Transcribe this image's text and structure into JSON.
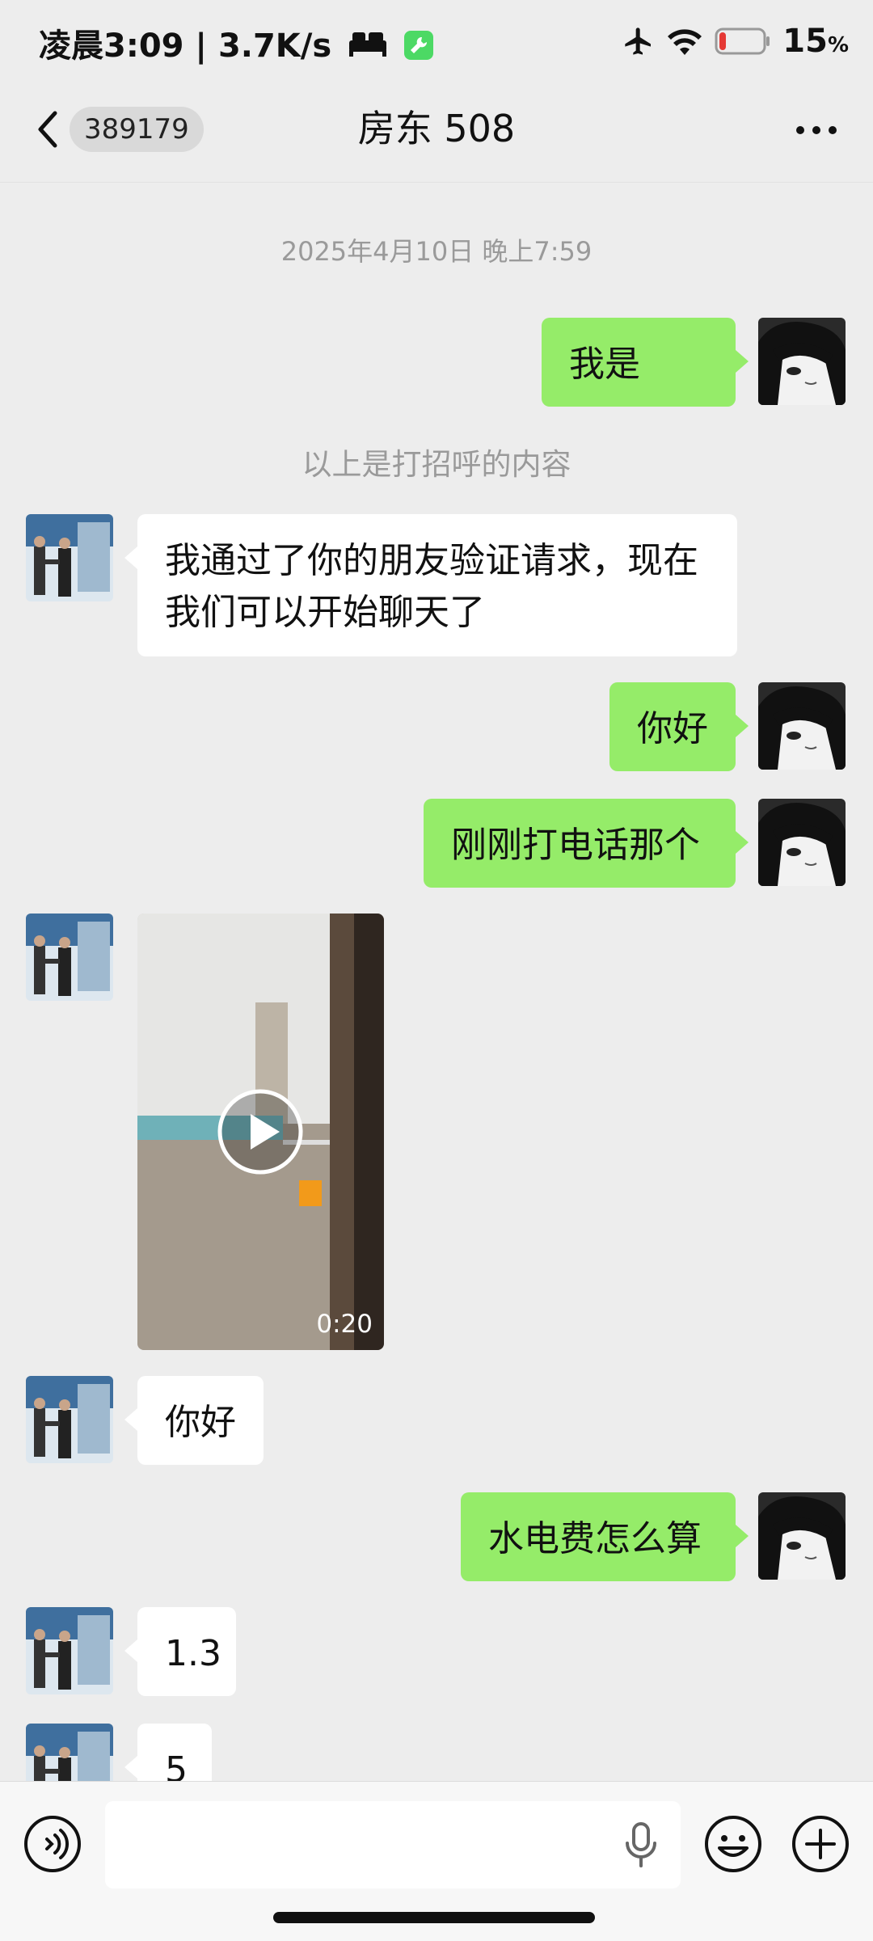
{
  "status_bar": {
    "time_speed": "凌晨3:09 | 3.7K/s",
    "battery_percent": "15",
    "battery_unit": "%",
    "battery_level": 0.15,
    "icons": [
      "bed-icon",
      "tool-app-icon",
      "airplane-icon",
      "wifi-icon",
      "battery-icon"
    ]
  },
  "header": {
    "unread_count": "389179",
    "title": "房东 508",
    "back_icon": "chevron-left-icon",
    "more_icon": "more-dots-icon"
  },
  "chat": {
    "timestamp": "2025年4月10日 晚上7:59",
    "greeting_notice": "以上是打招呼的内容",
    "messages": [
      {
        "sender": "me",
        "text": "我是"
      },
      {
        "sender": "other",
        "text": "我通过了你的朋友验证请求，现在我们可以开始聊天了"
      },
      {
        "sender": "me",
        "text": "你好"
      },
      {
        "sender": "me",
        "text": "刚刚打电话那个"
      },
      {
        "sender": "other",
        "type": "video",
        "duration": "0:20"
      },
      {
        "sender": "other",
        "text": "你好"
      },
      {
        "sender": "me",
        "text": "水电费怎么算"
      },
      {
        "sender": "other",
        "text": "1.3"
      },
      {
        "sender": "other",
        "text": "5"
      }
    ]
  },
  "input_bar": {
    "value": "",
    "icons": [
      "voice-icon",
      "microphone-icon",
      "emoji-icon",
      "plus-icon"
    ]
  },
  "colors": {
    "background": "#ededed",
    "my_bubble": "#95ec69",
    "other_bubble": "#ffffff",
    "battery_low": "#e53935",
    "app_icon": "#4cd964"
  }
}
